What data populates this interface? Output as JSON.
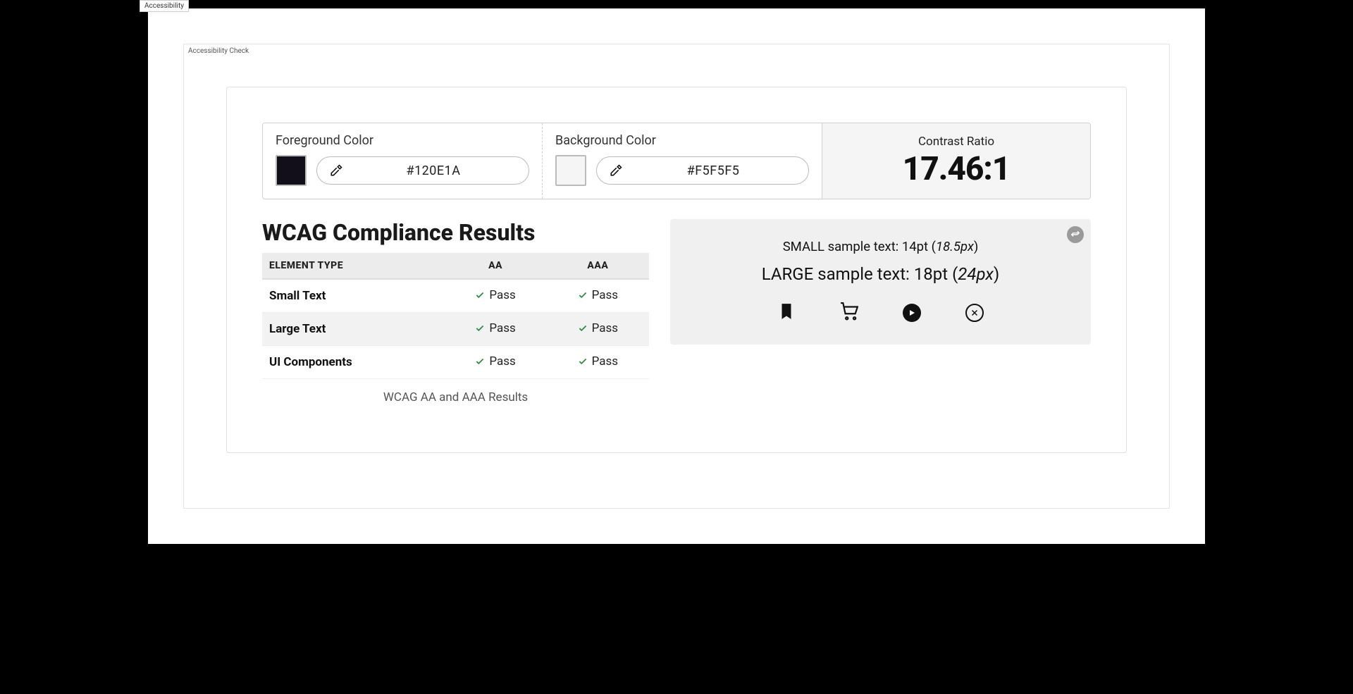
{
  "topTab": "Accessibility",
  "section": "Accessibility Check",
  "colors": {
    "foreground": {
      "label": "Foreground Color",
      "hex": "#120E1A",
      "swatch": "#120E1A"
    },
    "background": {
      "label": "Background Color",
      "hex": "#F5F5F5",
      "swatch": "#F5F5F5"
    }
  },
  "contrast": {
    "label": "Contrast Ratio",
    "value": "17.46:1"
  },
  "results": {
    "title": "WCAG Compliance Results",
    "headers": {
      "type": "ELEMENT TYPE",
      "aa": "AA",
      "aaa": "AAA"
    },
    "rows": [
      {
        "type": "Small Text",
        "aa": "Pass",
        "aaa": "Pass"
      },
      {
        "type": "Large Text",
        "aa": "Pass",
        "aaa": "Pass"
      },
      {
        "type": "UI Components",
        "aa": "Pass",
        "aaa": "Pass"
      }
    ],
    "caption": "WCAG AA and AAA Results"
  },
  "sample": {
    "small_pre": "SMALL sample text: 14pt (",
    "small_em": "18.5px",
    "small_post": ")",
    "large_pre": "LARGE sample text: 18pt (",
    "large_em": "24px",
    "large_post": ")"
  },
  "icons": {
    "bookmark": "bookmark-icon",
    "cart": "cart-icon",
    "play": "play-icon",
    "close": "close-circle-icon",
    "swap": "swap-icon",
    "dropper": "eyedropper-icon",
    "check": "check-icon"
  }
}
